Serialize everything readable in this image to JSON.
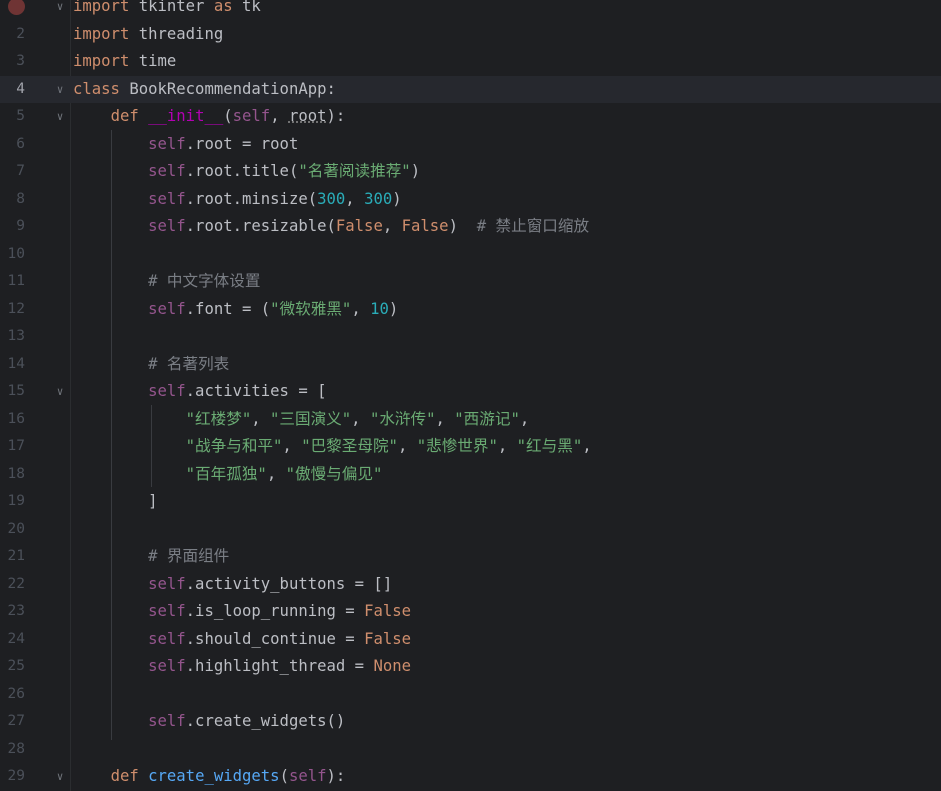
{
  "editor": {
    "current_line": 4,
    "breakpoint_line": 1,
    "lines": [
      {
        "n": "",
        "tokens": [
          {
            "c": "kw",
            "t": "import"
          },
          {
            "c": "",
            "t": " tkinter "
          },
          {
            "c": "kw",
            "t": "as"
          },
          {
            "c": "",
            "t": " tk"
          }
        ]
      },
      {
        "n": "2",
        "tokens": [
          {
            "c": "kw",
            "t": "import"
          },
          {
            "c": "",
            "t": " threading"
          }
        ]
      },
      {
        "n": "3",
        "tokens": [
          {
            "c": "kw",
            "t": "import"
          },
          {
            "c": "",
            "t": " time"
          }
        ]
      },
      {
        "n": "4",
        "tokens": [
          {
            "c": "kw",
            "t": "class"
          },
          {
            "c": "",
            "t": " BookRecommendationApp:"
          }
        ]
      },
      {
        "n": "5",
        "tokens": [
          {
            "c": "",
            "t": "    "
          },
          {
            "c": "kw",
            "t": "def"
          },
          {
            "c": "",
            "t": " "
          },
          {
            "c": "dunder",
            "t": "__init__"
          },
          {
            "c": "",
            "t": "("
          },
          {
            "c": "self",
            "t": "self"
          },
          {
            "c": "",
            "t": ", "
          },
          {
            "c": "param-underline",
            "t": "root"
          },
          {
            "c": "",
            "t": "):"
          }
        ]
      },
      {
        "n": "6",
        "tokens": [
          {
            "c": "",
            "t": "        "
          },
          {
            "c": "self",
            "t": "self"
          },
          {
            "c": "",
            "t": ".root = root"
          }
        ]
      },
      {
        "n": "7",
        "tokens": [
          {
            "c": "",
            "t": "        "
          },
          {
            "c": "self",
            "t": "self"
          },
          {
            "c": "",
            "t": ".root.title("
          },
          {
            "c": "str",
            "t": "\"名著阅读推荐\""
          },
          {
            "c": "",
            "t": ")"
          }
        ]
      },
      {
        "n": "8",
        "tokens": [
          {
            "c": "",
            "t": "        "
          },
          {
            "c": "self",
            "t": "self"
          },
          {
            "c": "",
            "t": ".root.minsize("
          },
          {
            "c": "num",
            "t": "300"
          },
          {
            "c": "",
            "t": ", "
          },
          {
            "c": "num",
            "t": "300"
          },
          {
            "c": "",
            "t": ")"
          }
        ]
      },
      {
        "n": "9",
        "tokens": [
          {
            "c": "",
            "t": "        "
          },
          {
            "c": "self",
            "t": "self"
          },
          {
            "c": "",
            "t": ".root.resizable("
          },
          {
            "c": "kw",
            "t": "False"
          },
          {
            "c": "",
            "t": ", "
          },
          {
            "c": "kw",
            "t": "False"
          },
          {
            "c": "",
            "t": ")  "
          },
          {
            "c": "cmt",
            "t": "# 禁止窗口缩放"
          }
        ]
      },
      {
        "n": "10",
        "tokens": []
      },
      {
        "n": "11",
        "tokens": [
          {
            "c": "",
            "t": "        "
          },
          {
            "c": "cmt",
            "t": "# 中文字体设置"
          }
        ]
      },
      {
        "n": "12",
        "tokens": [
          {
            "c": "",
            "t": "        "
          },
          {
            "c": "self",
            "t": "self"
          },
          {
            "c": "",
            "t": ".font = ("
          },
          {
            "c": "str",
            "t": "\"微软雅黑\""
          },
          {
            "c": "",
            "t": ", "
          },
          {
            "c": "num",
            "t": "10"
          },
          {
            "c": "",
            "t": ")"
          }
        ]
      },
      {
        "n": "13",
        "tokens": []
      },
      {
        "n": "14",
        "tokens": [
          {
            "c": "",
            "t": "        "
          },
          {
            "c": "cmt",
            "t": "# 名著列表"
          }
        ]
      },
      {
        "n": "15",
        "tokens": [
          {
            "c": "",
            "t": "        "
          },
          {
            "c": "self",
            "t": "self"
          },
          {
            "c": "",
            "t": ".activities = ["
          }
        ]
      },
      {
        "n": "16",
        "tokens": [
          {
            "c": "",
            "t": "            "
          },
          {
            "c": "str",
            "t": "\"红楼梦\""
          },
          {
            "c": "",
            "t": ", "
          },
          {
            "c": "str",
            "t": "\"三国演义\""
          },
          {
            "c": "",
            "t": ", "
          },
          {
            "c": "str",
            "t": "\"水浒传\""
          },
          {
            "c": "",
            "t": ", "
          },
          {
            "c": "str",
            "t": "\"西游记\""
          },
          {
            "c": "",
            "t": ","
          }
        ]
      },
      {
        "n": "17",
        "tokens": [
          {
            "c": "",
            "t": "            "
          },
          {
            "c": "str",
            "t": "\"战争与和平\""
          },
          {
            "c": "",
            "t": ", "
          },
          {
            "c": "str",
            "t": "\"巴黎圣母院\""
          },
          {
            "c": "",
            "t": ", "
          },
          {
            "c": "str",
            "t": "\"悲惨世界\""
          },
          {
            "c": "",
            "t": ", "
          },
          {
            "c": "str",
            "t": "\"红与黑\""
          },
          {
            "c": "",
            "t": ","
          }
        ]
      },
      {
        "n": "18",
        "tokens": [
          {
            "c": "",
            "t": "            "
          },
          {
            "c": "str",
            "t": "\"百年孤独\""
          },
          {
            "c": "",
            "t": ", "
          },
          {
            "c": "str",
            "t": "\"傲慢与偏见\""
          }
        ]
      },
      {
        "n": "19",
        "tokens": [
          {
            "c": "",
            "t": "        ]"
          }
        ]
      },
      {
        "n": "20",
        "tokens": []
      },
      {
        "n": "21",
        "tokens": [
          {
            "c": "",
            "t": "        "
          },
          {
            "c": "cmt",
            "t": "# 界面组件"
          }
        ]
      },
      {
        "n": "22",
        "tokens": [
          {
            "c": "",
            "t": "        "
          },
          {
            "c": "self",
            "t": "self"
          },
          {
            "c": "",
            "t": ".activity_buttons = []"
          }
        ]
      },
      {
        "n": "23",
        "tokens": [
          {
            "c": "",
            "t": "        "
          },
          {
            "c": "self",
            "t": "self"
          },
          {
            "c": "",
            "t": ".is_loop_running = "
          },
          {
            "c": "kw",
            "t": "False"
          }
        ]
      },
      {
        "n": "24",
        "tokens": [
          {
            "c": "",
            "t": "        "
          },
          {
            "c": "self",
            "t": "self"
          },
          {
            "c": "",
            "t": ".should_continue = "
          },
          {
            "c": "kw",
            "t": "False"
          }
        ]
      },
      {
        "n": "25",
        "tokens": [
          {
            "c": "",
            "t": "        "
          },
          {
            "c": "self",
            "t": "self"
          },
          {
            "c": "",
            "t": ".highlight_thread = "
          },
          {
            "c": "kw",
            "t": "None"
          }
        ]
      },
      {
        "n": "26",
        "tokens": []
      },
      {
        "n": "27",
        "tokens": [
          {
            "c": "",
            "t": "        "
          },
          {
            "c": "self",
            "t": "self"
          },
          {
            "c": "",
            "t": ".create_widgets()"
          }
        ]
      },
      {
        "n": "28",
        "tokens": []
      },
      {
        "n": "29",
        "tokens": [
          {
            "c": "",
            "t": "    "
          },
          {
            "c": "kw",
            "t": "def"
          },
          {
            "c": "",
            "t": " "
          },
          {
            "c": "fn",
            "t": "create_widgets"
          },
          {
            "c": "",
            "t": "("
          },
          {
            "c": "self",
            "t": "self"
          },
          {
            "c": "",
            "t": "):"
          }
        ]
      }
    ],
    "fold_lines": [
      1,
      4,
      5,
      15,
      29
    ]
  }
}
